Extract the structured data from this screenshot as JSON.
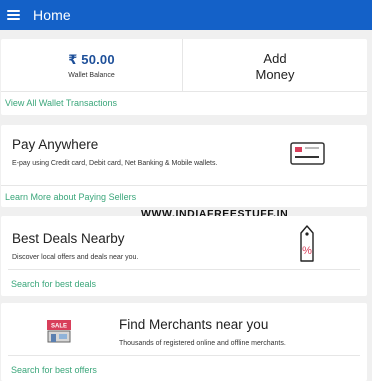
{
  "appbar": {
    "title": "Home",
    "menu_icon": "menu-icon"
  },
  "wallet": {
    "amount": "₹ 50.00",
    "balance_label": "Wallet Balance",
    "add_money_line1": "Add",
    "add_money_line2": "Money",
    "view_transactions": "View All Wallet Transactions"
  },
  "pay_anywhere": {
    "title": "Pay Anywhere",
    "description": "E-pay using Credit card, Debit card, Net Banking & Mobile wallets.",
    "link": "Learn More about Paying Sellers",
    "icon": "credit-card-icon"
  },
  "watermark": "WWW.INDIAFREESTUFF.IN",
  "best_deals": {
    "title": "Best Deals Nearby",
    "description": "Discover local offers and deals near you.",
    "link": "Search for best deals",
    "icon": "price-tag-icon",
    "icon_text": "%"
  },
  "merchants": {
    "title": "Find Merchants near you",
    "description": "Thousands of registered online and offline merchants.",
    "link": "Search for best offers",
    "icon": "sale-store-icon",
    "icon_text": "SALE"
  },
  "colors": {
    "appbar": "#1461c8",
    "link": "#3aa67a",
    "amount": "#1d4f99"
  }
}
